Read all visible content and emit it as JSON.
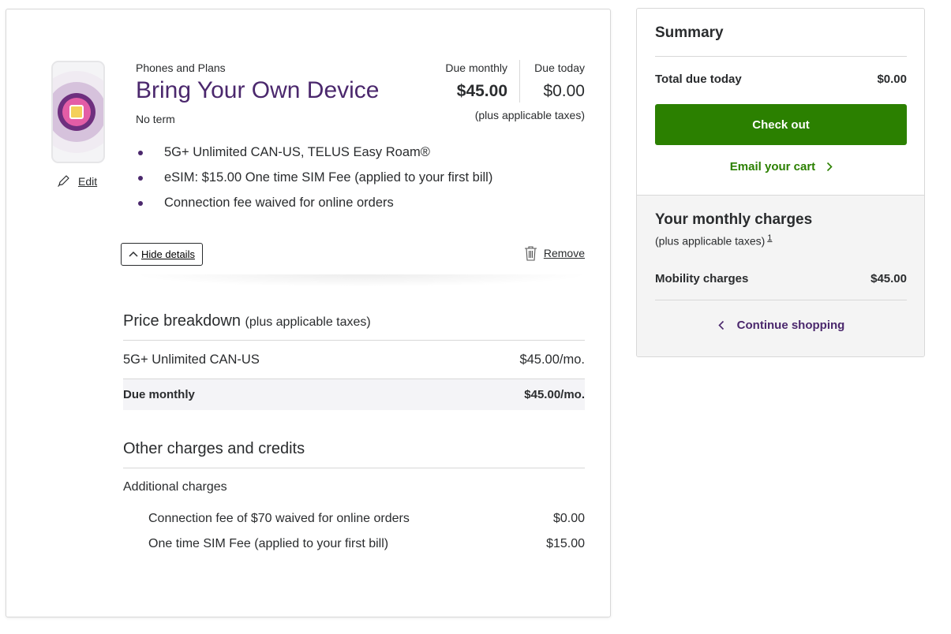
{
  "cart_item": {
    "eyebrow": "Phones and Plans",
    "title": "Bring Your Own Device",
    "term": "No term",
    "edit_label": "Edit",
    "due_monthly_label": "Due monthly",
    "due_monthly_value": "$45.00",
    "due_today_label": "Due today",
    "due_today_value": "$0.00",
    "taxes_note": "(plus applicable taxes)",
    "features": [
      "5G+ Unlimited CAN-US, TELUS Easy Roam®",
      "eSIM: $15.00 One time SIM Fee (applied to your first bill)",
      "Connection fee waived for online orders"
    ],
    "hide_details_label": "Hide details",
    "remove_label": "Remove"
  },
  "price_breakdown": {
    "title": "Price breakdown",
    "title_sub": "(plus applicable taxes)",
    "rows": [
      {
        "label": "5G+ Unlimited CAN-US",
        "value": "$45.00/mo."
      }
    ],
    "total": {
      "label": "Due monthly",
      "value": "$45.00/mo."
    }
  },
  "other_charges": {
    "title": "Other charges and credits",
    "group_label": "Additional charges",
    "rows": [
      {
        "label": "Connection fee of $70 waived for online orders",
        "value": "$0.00"
      },
      {
        "label": "One time SIM Fee (applied to your first bill)",
        "value": "$15.00"
      }
    ]
  },
  "summary": {
    "title": "Summary",
    "total_due_label": "Total due today",
    "total_due_value": "$0.00",
    "checkout_label": "Check out",
    "email_cart_label": "Email your cart",
    "monthly_title": "Your monthly charges",
    "monthly_sub": "(plus applicable taxes)",
    "monthly_footnote": "1",
    "mobility_label": "Mobility charges",
    "mobility_value": "$45.00",
    "continue_label": "Continue shopping"
  },
  "colors": {
    "brand_purple": "#4b286d",
    "checkout_green": "#2b8000"
  },
  "icons": [
    "sim-chip-icon",
    "pencil-icon",
    "chevron-up-icon",
    "trash-icon",
    "chevron-right-icon",
    "chevron-left-icon"
  ]
}
